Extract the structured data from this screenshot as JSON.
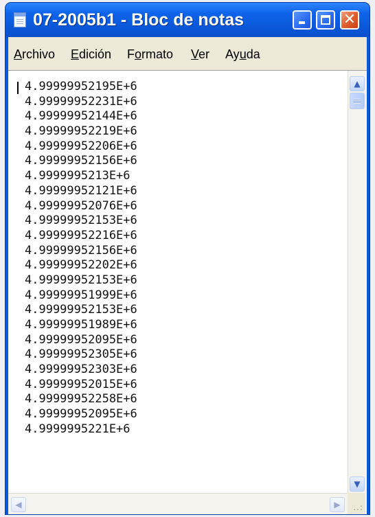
{
  "window": {
    "title": "07-2005b1 - Bloc de notas"
  },
  "menu": [
    {
      "pre": "",
      "acc": "A",
      "post": "rchivo"
    },
    {
      "pre": "",
      "acc": "E",
      "post": "dición"
    },
    {
      "pre": "F",
      "acc": "o",
      "post": "rmato"
    },
    {
      "pre": "",
      "acc": "V",
      "post": "er"
    },
    {
      "pre": "Ay",
      "acc": "u",
      "post": "da"
    }
  ],
  "document": {
    "lines": [
      "4.99999952195E+6",
      "4.99999952231E+6",
      "4.99999952144E+6",
      "4.99999952219E+6",
      "4.99999952206E+6",
      "4.99999952156E+6",
      "4.9999995213E+6",
      "4.99999952121E+6",
      "4.99999952076E+6",
      "4.99999952153E+6",
      "4.99999952216E+6",
      "4.99999952156E+6",
      "4.99999952202E+6",
      "4.99999952153E+6",
      "4.99999951999E+6",
      "4.99999952153E+6",
      "4.99999951989E+6",
      "4.99999952095E+6",
      "4.99999952305E+6",
      "4.99999952303E+6",
      "4.99999952015E+6",
      "4.99999952258E+6",
      "4.99999952095E+6",
      "4.9999995221E+6"
    ]
  },
  "icons": {
    "app": "notepad-icon",
    "minimize": "minimize-icon",
    "maximize": "maximize-icon",
    "close": "close-icon",
    "scroll_up": "chevron-up-icon",
    "scroll_down": "chevron-down-icon",
    "scroll_left": "chevron-left-icon",
    "scroll_right": "chevron-right-icon",
    "resize": "resize-grip-icon"
  },
  "colors": {
    "titlebar": "#0a58d9",
    "close_button": "#e0602f",
    "menubar": "#ece9d8"
  }
}
